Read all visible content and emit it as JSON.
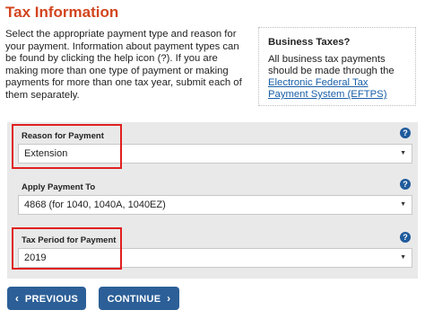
{
  "page": {
    "title": "Tax Information",
    "intro": "Select the appropriate payment type and reason for your payment. Information about payment types can be found by clicking the help icon (?). If you are making more than one type of payment or making payments for more than one tax year, submit each of them separately."
  },
  "sidebar": {
    "title": "Business Taxes?",
    "text": "All business tax payments should be made through the ",
    "link": "Electronic Federal Tax Payment System (EFTPS)"
  },
  "form": {
    "reason": {
      "label": "Reason for Payment",
      "value": "Extension"
    },
    "apply": {
      "label": "Apply Payment To",
      "value": "4868 (for 1040, 1040A, 1040EZ)"
    },
    "period": {
      "label": "Tax Period for Payment",
      "value": "2019"
    },
    "help_glyph": "?",
    "arrow_glyph": "▼"
  },
  "buttons": {
    "previous": "PREVIOUS",
    "continue": "CONTINUE",
    "prev_chev": "‹",
    "next_chev": "›"
  },
  "colors": {
    "title": "#d2451e",
    "button": "#2c5f97",
    "highlight": "#e0201f",
    "link": "#1a5fa8"
  }
}
